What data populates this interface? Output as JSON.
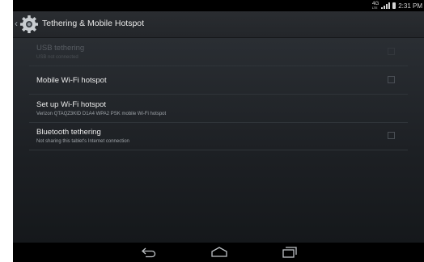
{
  "status_bar": {
    "network": "4G",
    "network_sub": "LTE",
    "time": "2:31 PM"
  },
  "action_bar": {
    "title": "Tethering & Mobile Hotspot",
    "icon": "settings-gear-icon"
  },
  "preferences": [
    {
      "title": "USB tethering",
      "summary": "USB not connected",
      "enabled": false,
      "checked": false
    },
    {
      "title": "Mobile Wi-Fi hotspot",
      "summary": "",
      "enabled": true,
      "checked": false
    },
    {
      "title": "Set up Wi-Fi hotspot",
      "summary": "Verizon QTAQZ3KID D1A4 WPA2 PSK mobile Wi-Fi hotspot",
      "enabled": true
    },
    {
      "title": "Bluetooth tethering",
      "summary": "Not sharing this tablet's Internet connection",
      "enabled": true,
      "checked": false
    }
  ],
  "navigation": {
    "back": "back-icon",
    "home": "home-icon",
    "recents": "recent-apps-icon"
  }
}
